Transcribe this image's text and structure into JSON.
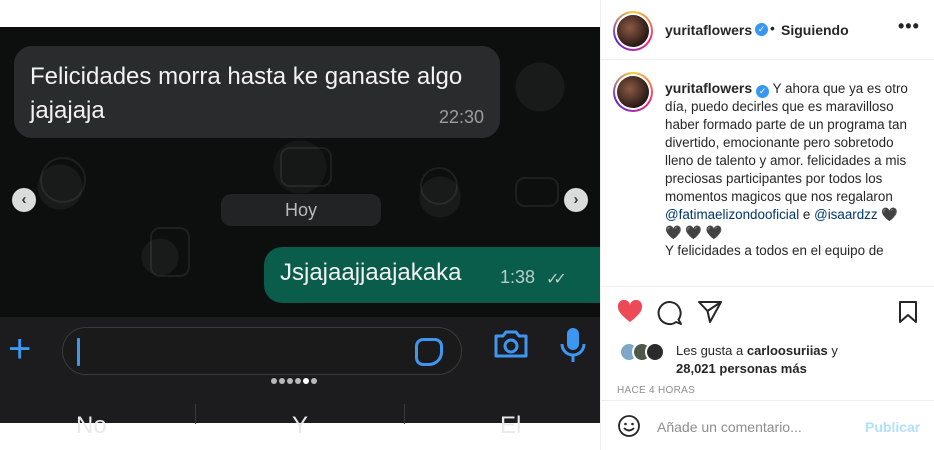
{
  "media": {
    "incoming_message": "Felicidades morra hasta ke ganaste algo jajajaja",
    "incoming_time": "22:30",
    "day_label": "Hoy",
    "outgoing_message": "Jsjajaajjaajakaka",
    "outgoing_time": "1:38",
    "read_ticks": "✓✓",
    "keyboard_keys": [
      "No",
      "Y",
      "El"
    ],
    "carousel_slide_count": 6,
    "carousel_active_index": 4
  },
  "post": {
    "username": "yuritaflowers",
    "follow_status": "Siguiendo",
    "caption_text": "Y ahora que ya es otro día, puedo decirles que es maravilloso haber formado parte de un programa tan divertido, emocionante pero sobretodo lleno de talento y amor. felicidades a mis preciosas participantes por todos los momentos magicos que nos regalaron",
    "mention_1": "@fatimaelizondooficial",
    "mention_joiner": "e",
    "mention_2": "@isaardzz",
    "hearts": "🖤 🖤 🖤 🖤",
    "caption_more": "Y felicidades a todos en el equipo de",
    "likes_prefix": "Les gusta a",
    "likes_user": "carloosuriias",
    "likes_suffix": "y",
    "likes_count": "28,021 personas más",
    "time_ago": "HACE 4 HORAS",
    "comment_placeholder": "Añade un comentario...",
    "publish_label": "Publicar"
  },
  "icons": {
    "verified": "verified-badge-icon",
    "like": "heart-filled-icon",
    "comment": "comment-bubble-icon",
    "share": "paper-plane-icon",
    "save": "bookmark-icon",
    "more": "more-options-icon",
    "emoji": "emoji-icon"
  },
  "colors": {
    "like_red": "#ed4956",
    "verified_blue": "#3897f0",
    "whatsapp_outgoing": "#0a5c4b",
    "whatsapp_accent": "#3d96f0",
    "publish_disabled": "#b2dffc"
  }
}
